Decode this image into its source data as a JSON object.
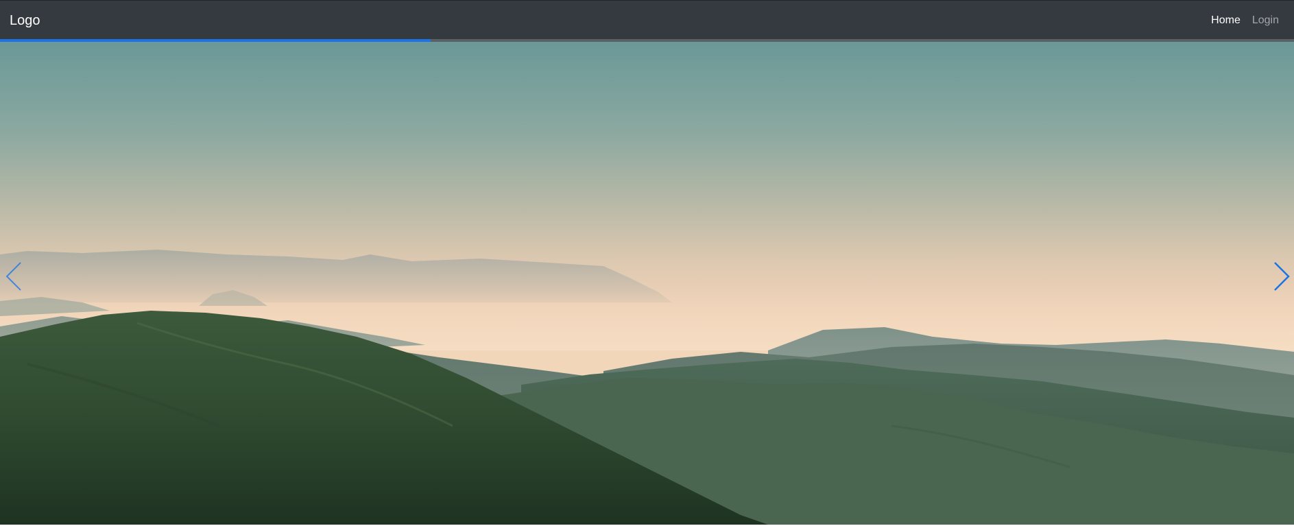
{
  "navbar": {
    "logo_text": "Logo",
    "links": [
      {
        "label": "Home",
        "active": true
      },
      {
        "label": "Login",
        "active": false
      }
    ],
    "background_color": "#343a40"
  },
  "progress": {
    "fraction": 0.333,
    "fill_color": "#1a73e8",
    "track_color": "#5a6066"
  },
  "carousel": {
    "slide_description_icon": "landscape-photo",
    "prev_icon": "chevron-left-icon",
    "next_icon": "chevron-right-icon",
    "arrow_color": "#1a73e8"
  }
}
